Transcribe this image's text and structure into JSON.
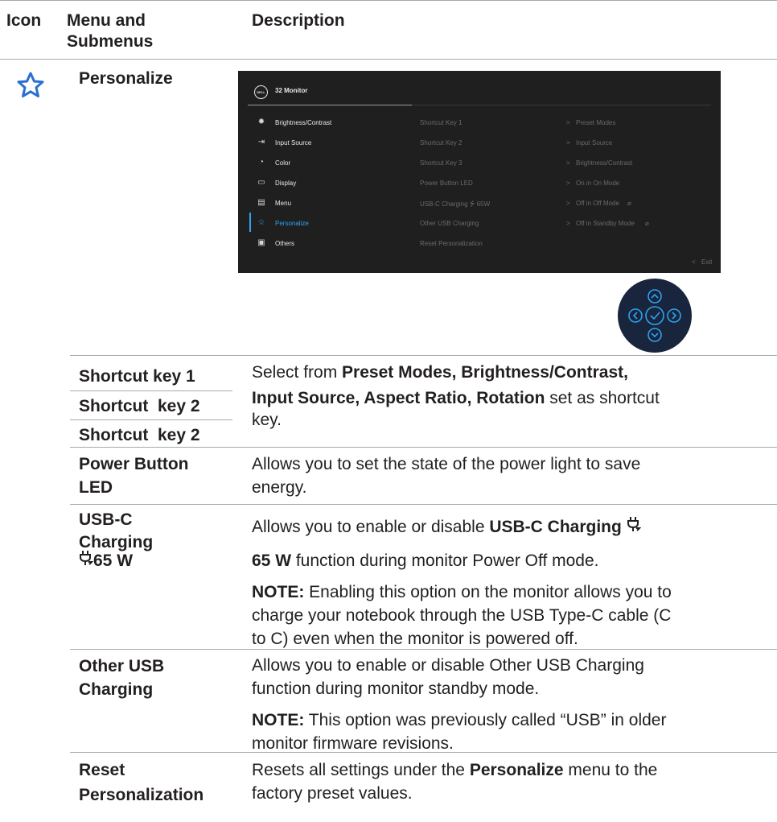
{
  "header": {
    "icon": "Icon",
    "menu": "Menu and Submenus",
    "description": "Description"
  },
  "section": {
    "icon": "star-icon",
    "title": "Personalize",
    "accent_color": "#2a6fd0"
  },
  "osd": {
    "logo": "DELL",
    "title": "32 Monitor",
    "menu_items": [
      {
        "label": "Brightness/Contrast",
        "icon": "sun-icon"
      },
      {
        "label": "Input Source",
        "icon": "input-icon"
      },
      {
        "label": "Color",
        "icon": "palette-icon"
      },
      {
        "label": "Display",
        "icon": "display-icon"
      },
      {
        "label": "Menu",
        "icon": "menu-icon"
      },
      {
        "label": "Personalize",
        "icon": "star-icon"
      },
      {
        "label": "Others",
        "icon": "others-icon"
      }
    ],
    "options": [
      "Shortcut Key 1",
      "Shortcut Key 2",
      "Shortcut Key 3",
      "Power Button LED",
      "USB-C Charging ⭍ 65W",
      "Other USB Charging",
      "Reset Personalization"
    ],
    "values": [
      "Preset Modes",
      "Input Source",
      "Brightness/Contrast",
      "On in On Mode",
      "Off in Off Mode",
      "Off in Standby Mode"
    ],
    "exit": "Exit",
    "selected_color": "#2ea3f2"
  },
  "rows": {
    "shortcut1": "Shortcut key 1",
    "shortcut2": "Shortcut  key 2",
    "shortcut3": "Shortcut  key 2",
    "shortcut_desc": {
      "pre": "Select from ",
      "bold1": "Preset Modes, Brightness/Contrast,",
      "bold2": "Input Source, Aspect Ratio, Rotation",
      "post": " set as shortcut",
      "post2": "key."
    },
    "power_led_term1": "Power Button",
    "power_led_term2": "LED",
    "power_led_desc1": "Allows you to set the state of the power light to save",
    "power_led_desc2": "energy.",
    "usbc_term1": "USB-C",
    "usbc_term2": "Charging",
    "usbc_term3": "65 W",
    "usbc_desc_pre": "Allows you to enable or disable ",
    "usbc_desc_bold": "USB-C Charging",
    "usbc_desc_bold2": "65 W",
    "usbc_desc_post": " function during monitor Power Off mode.",
    "usbc_note_label": "NOTE:",
    "usbc_note1": " Enabling this option on the monitor allows you to",
    "usbc_note2": "charge your notebook through the USB Type-C cable (C",
    "usbc_note3": "to C) even when the monitor is powered off.",
    "other_term1": "Other USB",
    "other_term2": "Charging",
    "other_desc1": "Allows you to enable or disable Other USB Charging",
    "other_desc2": "function during monitor standby mode.",
    "other_note_label": "NOTE:",
    "other_note1": " This option was previously called “USB” in older",
    "other_note2": "monitor firmware revisions.",
    "reset_term1": "Reset",
    "reset_term2": "Personalization",
    "reset_desc_pre": "Resets all settings under the ",
    "reset_desc_bold": "Personalize",
    "reset_desc_post": " menu to the",
    "reset_desc2": "factory preset values."
  }
}
